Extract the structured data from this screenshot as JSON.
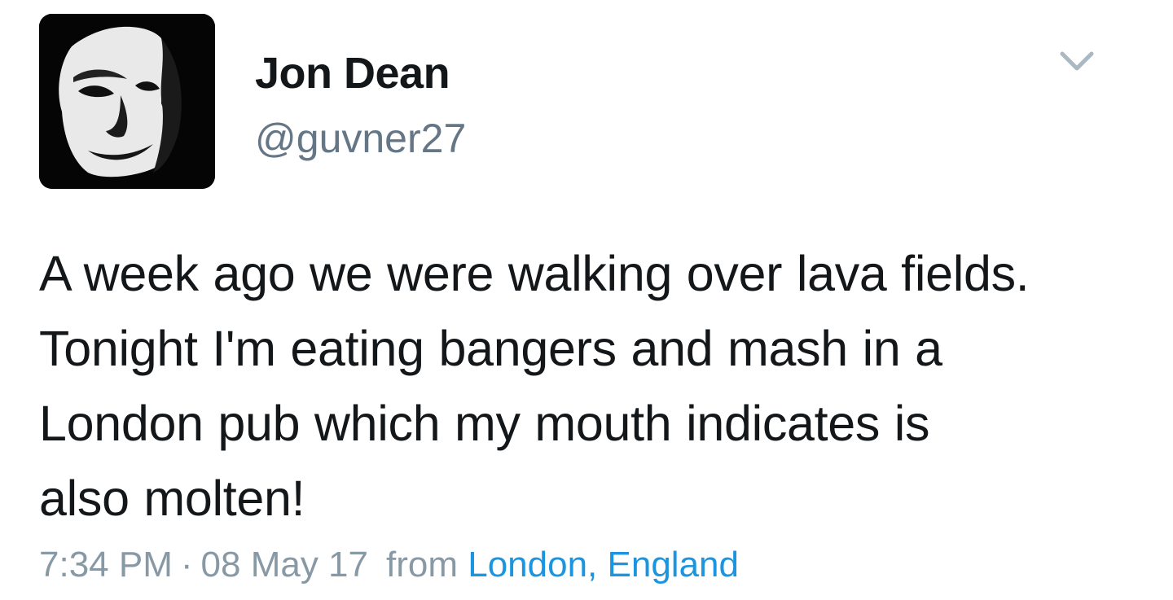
{
  "author": {
    "display_name": "Jon Dean",
    "handle": "@guvner27",
    "avatar_icon": "profile-photo"
  },
  "menu": {
    "icon": "chevron-down-icon"
  },
  "tweet": {
    "lines": [
      "A week ago we were walking over lava fields.",
      "Tonight I'm eating bangers and mash in a",
      "London pub which my mouth indicates is",
      "also molten!"
    ]
  },
  "meta": {
    "time": "7:34 PM",
    "separator": "·",
    "date": "08 May 17",
    "from_label": "from",
    "location": "London, England"
  },
  "colors": {
    "text": "#14171a",
    "secondary": "#657786",
    "meta": "#8899a6",
    "link": "#1b95e0",
    "chevron": "#aab8c2"
  }
}
